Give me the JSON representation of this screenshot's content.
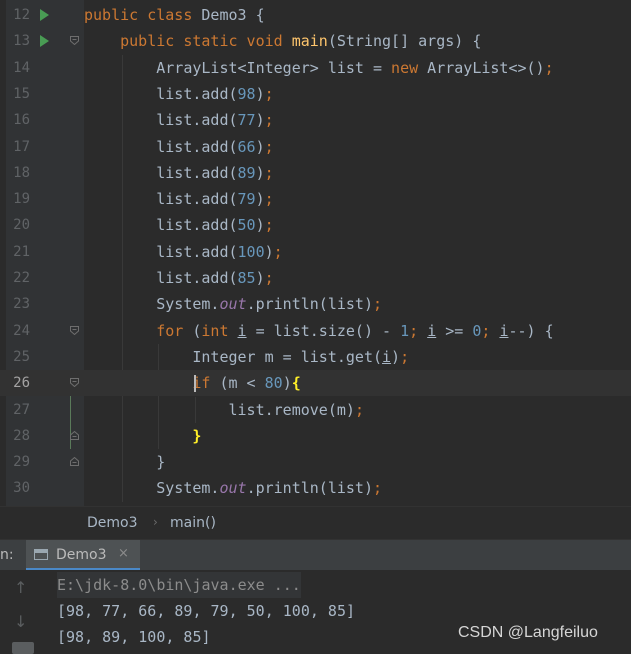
{
  "editor": {
    "lines": [
      {
        "n": "12",
        "parts": [
          [
            "kw",
            "public class "
          ],
          [
            "t",
            "Demo3 {"
          ]
        ]
      },
      {
        "n": "13",
        "parts": [
          [
            "t",
            "    "
          ],
          [
            "kw",
            "public static void "
          ],
          [
            "fn",
            "main"
          ],
          [
            "t",
            "(String[] args) {"
          ]
        ]
      },
      {
        "n": "14",
        "parts": [
          [
            "t",
            "        ArrayList<Integer> list = "
          ],
          [
            "kw",
            "new "
          ],
          [
            "t",
            "ArrayList<>()"
          ],
          [
            "kw",
            ";"
          ]
        ]
      },
      {
        "n": "15",
        "parts": [
          [
            "t",
            "        list.add("
          ],
          [
            "num",
            "98"
          ],
          [
            "t",
            ")"
          ],
          [
            "kw",
            ";"
          ]
        ]
      },
      {
        "n": "16",
        "parts": [
          [
            "t",
            "        list.add("
          ],
          [
            "num",
            "77"
          ],
          [
            "t",
            ")"
          ],
          [
            "kw",
            ";"
          ]
        ]
      },
      {
        "n": "17",
        "parts": [
          [
            "t",
            "        list.add("
          ],
          [
            "num",
            "66"
          ],
          [
            "t",
            ")"
          ],
          [
            "kw",
            ";"
          ]
        ]
      },
      {
        "n": "18",
        "parts": [
          [
            "t",
            "        list.add("
          ],
          [
            "num",
            "89"
          ],
          [
            "t",
            ")"
          ],
          [
            "kw",
            ";"
          ]
        ]
      },
      {
        "n": "19",
        "parts": [
          [
            "t",
            "        list.add("
          ],
          [
            "num",
            "79"
          ],
          [
            "t",
            ")"
          ],
          [
            "kw",
            ";"
          ]
        ]
      },
      {
        "n": "20",
        "parts": [
          [
            "t",
            "        list.add("
          ],
          [
            "num",
            "50"
          ],
          [
            "t",
            ")"
          ],
          [
            "kw",
            ";"
          ]
        ]
      },
      {
        "n": "21",
        "parts": [
          [
            "t",
            "        list.add("
          ],
          [
            "num",
            "100"
          ],
          [
            "t",
            ")"
          ],
          [
            "kw",
            ";"
          ]
        ]
      },
      {
        "n": "22",
        "parts": [
          [
            "t",
            "        list.add("
          ],
          [
            "num",
            "85"
          ],
          [
            "t",
            ")"
          ],
          [
            "kw",
            ";"
          ]
        ]
      },
      {
        "n": "23",
        "parts": [
          [
            "t",
            "        System."
          ],
          [
            "field",
            "out"
          ],
          [
            "t",
            ".println(list)"
          ],
          [
            "kw",
            ";"
          ]
        ]
      },
      {
        "n": "24",
        "parts": [
          [
            "t",
            "        "
          ],
          [
            "kw",
            "for "
          ],
          [
            "t",
            "("
          ],
          [
            "kw",
            "int "
          ],
          [
            "u",
            "i"
          ],
          [
            "t",
            " = list.size() - "
          ],
          [
            "num",
            "1"
          ],
          [
            "kw",
            "; "
          ],
          [
            "u",
            "i"
          ],
          [
            "t",
            " >= "
          ],
          [
            "num",
            "0"
          ],
          [
            "kw",
            "; "
          ],
          [
            "u",
            "i"
          ],
          [
            "t",
            "--) {"
          ]
        ]
      },
      {
        "n": "25",
        "parts": [
          [
            "t",
            "            Integer m = list.get("
          ],
          [
            "u",
            "i"
          ],
          [
            "t",
            ")"
          ],
          [
            "kw",
            ";"
          ]
        ]
      },
      {
        "n": "26",
        "parts": [
          [
            "t",
            "            "
          ],
          [
            "kw",
            "if "
          ],
          [
            "t",
            "(m < "
          ],
          [
            "num",
            "80"
          ],
          [
            "t",
            ")"
          ],
          [
            "hl",
            "{"
          ]
        ]
      },
      {
        "n": "27",
        "parts": [
          [
            "t",
            "                list.remove(m)"
          ],
          [
            "kw",
            ";"
          ]
        ]
      },
      {
        "n": "28",
        "parts": [
          [
            "t",
            "            "
          ],
          [
            "hl",
            "}"
          ]
        ]
      },
      {
        "n": "29",
        "parts": [
          [
            "t",
            "        }"
          ]
        ]
      },
      {
        "n": "30",
        "parts": [
          [
            "t",
            "        System."
          ],
          [
            "field",
            "out"
          ],
          [
            "t",
            ".println(list)"
          ],
          [
            "kw",
            ";"
          ]
        ]
      }
    ],
    "current_line": "26"
  },
  "breadcrumb": {
    "class_name": "Demo3",
    "separator": "›",
    "method": "main()"
  },
  "run_panel": {
    "label": "n:",
    "tab_label": "Demo3",
    "close_glyph": "×"
  },
  "console": {
    "command": "E:\\jdk-8.0\\bin\\java.exe ...",
    "output_1": "[98, 77, 66, 89, 79, 50, 100, 85]",
    "output_2": "[98, 89, 100, 85]"
  },
  "watermark": "CSDN @Langfeiluo",
  "icons": {
    "up": "↑",
    "down": "↓"
  },
  "colors": {
    "keyword": "#cc7832",
    "number": "#6897bb",
    "method": "#ffc66d",
    "field": "#9876aa",
    "text": "#a9b7c6",
    "tab_accent": "#4a88c7"
  }
}
